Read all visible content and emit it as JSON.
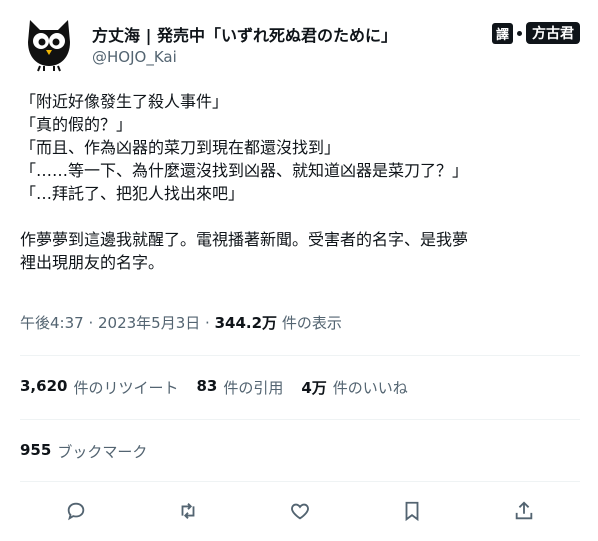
{
  "author": {
    "display_name": "方丈海 | 発売中「いずれ死ぬ君のために」",
    "handle": "@HOJO_Kai",
    "avatar_icon": "owl-avatar-icon"
  },
  "badge": {
    "tag": "譯",
    "logo": "方古君"
  },
  "tweet": {
    "lines": [
      "「附近好像發生了殺人事件」",
      "「真的假的？」",
      "「而且、作為凶器的菜刀到現在都還沒找到」",
      "「……等一下、為什麼還沒找到凶器、就知道凶器是菜刀了？」",
      "「…拜託了、把犯人找出來吧」",
      "作夢夢到這邊我就醒了。電視播著新聞。受害者的名字、是我夢",
      "裡出現朋友的名字。"
    ]
  },
  "meta": {
    "timestamp": "午後4:37 · 2023年5月3日 ·",
    "views_count": "344.2万",
    "views_label": "件の表示"
  },
  "stats": {
    "retweets_count": "3,620",
    "retweets_label": "件のリツイート",
    "quotes_count": "83",
    "quotes_label": "件の引用",
    "likes_count": "4万",
    "likes_label": "件のいいね"
  },
  "bookmarks": {
    "count": "955",
    "label": "ブックマーク"
  },
  "actions": [
    "reply-icon",
    "retweet-icon",
    "like-icon",
    "bookmark-icon",
    "share-icon"
  ],
  "colors": {
    "text": "#0f1419",
    "secondary": "#536471",
    "divider": "#eff3f4"
  }
}
